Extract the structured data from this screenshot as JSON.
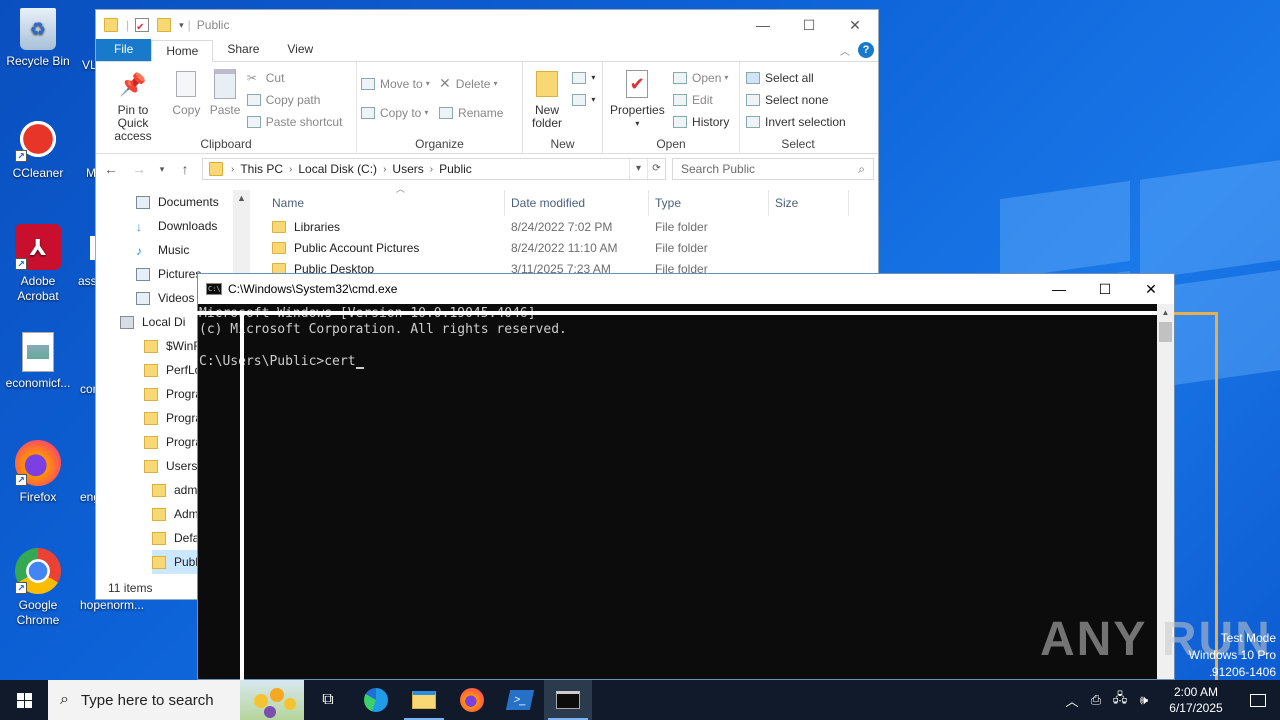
{
  "desktop": {
    "icons": [
      {
        "label": "Recycle Bin"
      },
      {
        "label": "CCleaner"
      },
      {
        "label": "Adobe Acrobat"
      },
      {
        "label": "economicf..."
      },
      {
        "label": "Firefox"
      },
      {
        "label": "Google Chrome"
      }
    ],
    "partial_labels": [
      "VL",
      "M",
      "ass",
      "con",
      "eng",
      "hopenorm..."
    ]
  },
  "explorer": {
    "title": "Public",
    "tabs": {
      "file": "File",
      "home": "Home",
      "share": "Share",
      "view": "View"
    },
    "ribbon": {
      "clipboard": {
        "pin": "Pin to Quick access",
        "copy": "Copy",
        "paste": "Paste",
        "cut": "Cut",
        "copy_path": "Copy path",
        "paste_shortcut": "Paste shortcut",
        "label": "Clipboard"
      },
      "organize": {
        "move_to": "Move to",
        "copy_to": "Copy to",
        "delete": "Delete",
        "rename": "Rename",
        "label": "Organize"
      },
      "new": {
        "new_folder": "New folder",
        "label": "New"
      },
      "open": {
        "properties": "Properties",
        "open": "Open",
        "edit": "Edit",
        "history": "History",
        "label": "Open"
      },
      "select": {
        "select_all": "Select all",
        "select_none": "Select none",
        "invert": "Invert selection",
        "label": "Select"
      }
    },
    "address": {
      "crumbs": [
        "This PC",
        "Local Disk (C:)",
        "Users",
        "Public"
      ]
    },
    "search": {
      "placeholder": "Search Public"
    },
    "nav": [
      {
        "label": "Documents",
        "icon": "documents-icon"
      },
      {
        "label": "Downloads",
        "icon": "downloads-icon"
      },
      {
        "label": "Music",
        "icon": "music-icon"
      },
      {
        "label": "Pictures",
        "icon": "pictures-icon"
      },
      {
        "label": "Videos",
        "icon": "videos-icon"
      },
      {
        "label": "Local Di",
        "icon": "drive-icon"
      },
      {
        "label": "$WinR",
        "icon": "folder-icon"
      },
      {
        "label": "PerfLo",
        "icon": "folder-icon"
      },
      {
        "label": "Progra",
        "icon": "folder-icon"
      },
      {
        "label": "Progra",
        "icon": "folder-icon"
      },
      {
        "label": "Progra",
        "icon": "folder-icon"
      },
      {
        "label": "Users",
        "icon": "folder-icon"
      },
      {
        "label": "adm",
        "icon": "folder-icon"
      },
      {
        "label": "Adm",
        "icon": "folder-icon"
      },
      {
        "label": "Defa",
        "icon": "folder-icon"
      },
      {
        "label": "Publ",
        "icon": "folder-icon"
      }
    ],
    "columns": {
      "name": "Name",
      "date": "Date modified",
      "type": "Type",
      "size": "Size"
    },
    "files": [
      {
        "name": "Libraries",
        "date": "8/24/2022 7:02 PM",
        "type": "File folder"
      },
      {
        "name": "Public Account Pictures",
        "date": "8/24/2022 11:10 AM",
        "type": "File folder"
      },
      {
        "name": "Public Desktop",
        "date": "3/11/2025 7:23 AM",
        "type": "File folder"
      }
    ],
    "status": "11 items"
  },
  "cmd": {
    "title": "C:\\Windows\\System32\\cmd.exe",
    "lines": [
      "Microsoft Windows [Version 10.0.19045.4046]",
      "(c) Microsoft Corporation. All rights reserved.",
      "",
      "C:\\Users\\Public>cert"
    ]
  },
  "watermark": {
    "text": "ANY RUN",
    "test_mode": "Test Mode",
    "edition": "Windows 10 Pro",
    "build": "Build 19041.vb_release.191206-1406"
  },
  "taskbar": {
    "search_placeholder": "Type here to search",
    "time": "2:00 AM",
    "date": "6/17/2025"
  },
  "colors": {
    "accent": "#1979ca",
    "desktop": "#0d63d8",
    "taskbar": "#101a2a"
  }
}
